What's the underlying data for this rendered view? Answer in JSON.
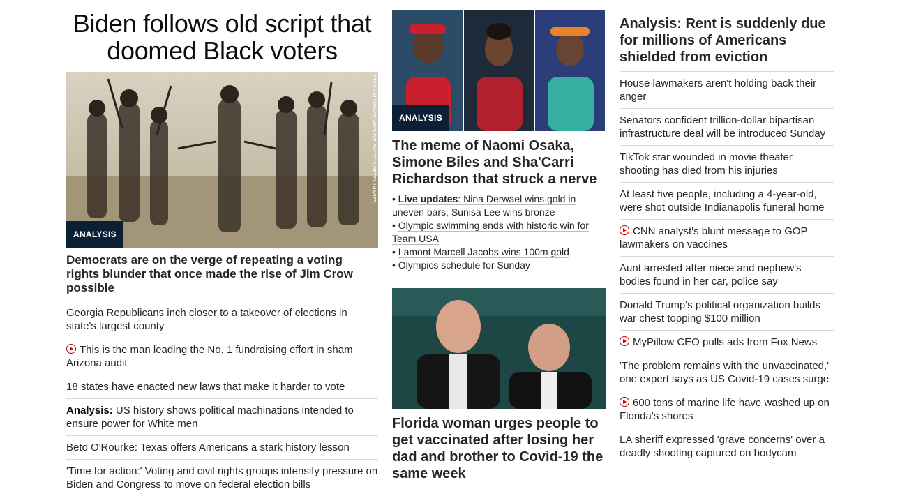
{
  "col1": {
    "banner_headline": "Biden follows old script that doomed Black voters",
    "image_credit": "STOCK MONTAGE/ARCHIVE PHOTOS/GETTY IMAGES",
    "badge": "ANALYSIS",
    "lead": "Democrats are on the verge of repeating a voting rights blunder that once made the rise of Jim Crow possible",
    "items": [
      {
        "kicker": "",
        "text": "Georgia Republicans inch closer to a takeover of elections in state's largest county",
        "video": false
      },
      {
        "kicker": "",
        "text": "This is the man leading the No. 1 fundraising effort in sham Arizona audit",
        "video": true
      },
      {
        "kicker": "",
        "text": "18 states have enacted new laws that make it harder to vote",
        "video": false
      },
      {
        "kicker": "Analysis:",
        "text": " US history shows political machinations intended to ensure power for White men",
        "video": false
      },
      {
        "kicker": "",
        "text": "Beto O'Rourke: Texas offers Americans a stark history lesson",
        "video": false
      },
      {
        "kicker": "",
        "text": "'Time for action:' Voting and civil rights groups intensify pressure on Biden and Congress to move on federal election bills",
        "video": false
      }
    ]
  },
  "col2": {
    "badge": "ANALYSIS",
    "headline": "The meme of Naomi Osaka, Simone Biles and Sha'Carri Richardson that struck a nerve",
    "bullets": [
      {
        "prefix": "• ",
        "bold": "Live updates",
        "text": ": Nina Derwael wins gold in uneven bars, Sunisa Lee wins bronze"
      },
      {
        "prefix": "• ",
        "bold": "",
        "text": "Olympic swimming ends with historic win for Team USA"
      },
      {
        "prefix": "• ",
        "bold": "",
        "text": "Lamont Marcell Jacobs wins 100m gold"
      },
      {
        "prefix": "• ",
        "bold": "",
        "text": "Olympics schedule for Sunday"
      }
    ],
    "headline2": "Florida woman urges people to get vaccinated after losing her dad and brother to Covid-19 the same week"
  },
  "col3": {
    "headline": "Analysis: Rent is suddenly due for millions of Americans shielded from eviction",
    "items": [
      {
        "text": "House lawmakers aren't holding back their anger",
        "video": false
      },
      {
        "text": "Senators confident trillion-dollar bipartisan infrastructure deal will be introduced Sunday",
        "video": false
      },
      {
        "text": "TikTok star wounded in movie theater shooting has died from his injuries",
        "video": false
      },
      {
        "text": "At least five people, including a 4-year-old, were shot outside Indianapolis funeral home",
        "video": false
      },
      {
        "text": "CNN analyst's blunt message to GOP lawmakers on vaccines",
        "video": true
      },
      {
        "text": "Aunt arrested after niece and nephew's bodies found in her car, police say",
        "video": false
      },
      {
        "text": "Donald Trump's political organization builds war chest topping $100 million",
        "video": false
      },
      {
        "text": "MyPillow CEO pulls ads from Fox News",
        "video": true
      },
      {
        "text": "'The problem remains with the unvaccinated,' one expert says as US Covid-19 cases surge",
        "video": false
      },
      {
        "text": "600 tons of marine life have washed up on Florida's shores",
        "video": true
      },
      {
        "text": "LA sheriff expressed 'grave concerns' over a deadly shooting captured on bodycam",
        "video": false
      }
    ]
  },
  "colors": {
    "badge_bg": "#0b1f35",
    "video_red": "#cc0000",
    "divider": "#d9d9d9",
    "text": "#262626"
  }
}
